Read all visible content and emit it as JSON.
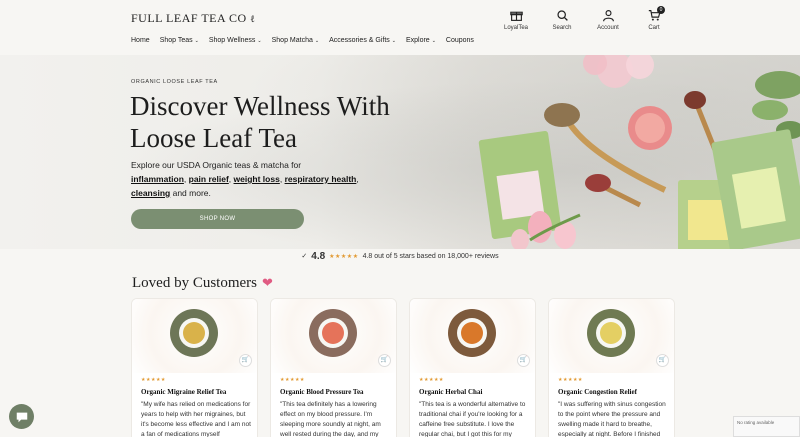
{
  "brand": {
    "logo_text": "FULL LEAF TEA CO"
  },
  "header_icons": [
    {
      "label": "LoyalTea",
      "icon": "gift-icon"
    },
    {
      "label": "Search",
      "icon": "search-icon"
    },
    {
      "label": "Account",
      "icon": "account-icon"
    },
    {
      "label": "Cart",
      "icon": "cart-icon"
    }
  ],
  "cart_count": "0",
  "nav": [
    "Home",
    "Shop Teas",
    "Shop Wellness",
    "Shop Matcha",
    "Accessories & Gifts",
    "Explore",
    "Coupons"
  ],
  "hero": {
    "eyebrow": "ORGANIC LOOSE LEAF TEA",
    "headline": "Discover Wellness With Loose Leaf Tea",
    "intro": "Explore our USDA Organic teas & matcha for",
    "links": [
      "inflammation",
      "pain relief",
      "weight loss",
      "respiratory health",
      "cleansing"
    ],
    "outro": "and more.",
    "cta": "SHOP NOW"
  },
  "rating": {
    "score": "4.8",
    "stars": "★★★★★",
    "text": "4.8 out of 5 stars based on 18,000+ reviews"
  },
  "section_title": "Loved by Customers",
  "reviews": [
    {
      "product": "Organic Migraine Relief Tea",
      "stars": "★★★★★",
      "quote": "\"My wife has relied on medications for years to help with her migraines, but it's become less effective and I am not a fan of medications myself",
      "tea_color": "#d9b24a"
    },
    {
      "product": "Organic Blood Pressure Tea",
      "stars": "★★★★★",
      "quote": "\"This tea definitely has a lowering effect on my blood pressure. I'm sleeping more soundly at night, am well rested during the day, and my",
      "tea_color": "#e5735a"
    },
    {
      "product": "Organic Herbal Chai",
      "stars": "★★★★★",
      "quote": "\"This tea is a wonderful alternative to traditional chai if you're looking for a caffeine free substitute. I love the regular chai, but I got this for my",
      "tea_color": "#d9782a"
    },
    {
      "product": "Organic Congestion Relief",
      "stars": "★★★★★",
      "quote": "\"I was suffering with sinus congestion to the point where the pressure and swelling made it hard to breathe, especially at night. Before I finished",
      "tea_color": "#e4cf63"
    }
  ],
  "recaptcha_text": "No rating available"
}
